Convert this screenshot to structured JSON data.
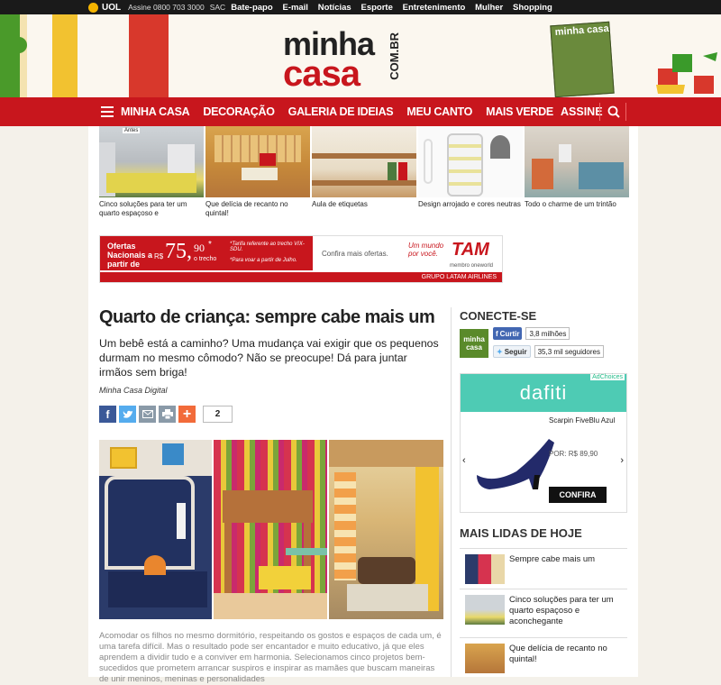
{
  "topbar": {
    "brand": "UOL",
    "assine_text": "Assine 0800 703 3000",
    "sac": "SAC",
    "links": [
      "Bate-papo",
      "E-mail",
      "Notícias",
      "Esporte",
      "Entretenimento",
      "Mulher",
      "Shopping"
    ]
  },
  "header": {
    "logo_line1": "minha",
    "logo_line2": "casa",
    "logo_suffix": "COM.BR",
    "magazine_title": "minha casa"
  },
  "nav": {
    "items": [
      "MINHA CASA",
      "DECORAÇÃO",
      "GALERIA DE IDEIAS",
      "MEU CANTO",
      "MAIS VERDE"
    ],
    "assine": "ASSINE"
  },
  "strip": [
    {
      "caption": "Cinco soluções para ter um quarto espaçoso e",
      "badge": "Antes"
    },
    {
      "caption": "Que delícia de recanto no quintal!"
    },
    {
      "caption": "Aula de etiquetas"
    },
    {
      "caption": "Design arrojado e cores neutras"
    },
    {
      "caption": "Todo o charme de um trintão"
    }
  ],
  "ad": {
    "offer": "Ofertas Nacionais a partir de",
    "currency": "R$",
    "price": "75,",
    "cents": "90",
    "star": "*",
    "per": "o trecho",
    "note1": "*Tarifa referente ao trecho VIX-SDU.",
    "note2": "*Para voar a partir de Julho.",
    "confirm": "Confira mais ofertas.",
    "slogan1": "Um mundo",
    "slogan2": "por você.",
    "airline": "TAM",
    "member": "membro oneworld",
    "group": "GRUPO LATAM AIRLINES"
  },
  "article": {
    "title": "Quarto de criança: sempre cabe mais um",
    "lead": "Um bebê está a caminho? Uma mudança vai exigir que os pequenos durmam no mesmo cômodo? Não se preocupe! Dá para juntar irmãos sem briga!",
    "byline": "Minha Casa Digital",
    "share_count": "2",
    "body": "Acomodar os filhos no mesmo dormitório, respeitando os gostos e espaços de cada um, é uma tarefa difícil. Mas o resultado pode ser encantador e muito educativo, já que eles aprendem a dividir tudo e a conviver em harmonia. Selecionamos cinco projetos bem-sucedidos que prometem arrancar suspiros e inspirar as mamães que buscam maneiras de unir meninos, meninas e personalidades"
  },
  "sidebar": {
    "conecte_title": "CONECTE-SE",
    "conecte_logo": "minha casa",
    "fb_label": "Curtir",
    "fb_count": "3,8 milhões",
    "tw_label": "Seguir",
    "tw_count": "35,3 mil seguidores",
    "ad": {
      "adchoices": "AdChoices",
      "brand": "dafiti",
      "product": "Scarpin FiveBlu Azul",
      "price": "POR: R$ 89,90",
      "cta": "CONFIRA"
    },
    "mais_title": "MAIS LIDAS DE HOJE",
    "mais": [
      {
        "text": "Sempre cabe mais um"
      },
      {
        "text": "Cinco soluções para ter um quarto espaçoso e aconchegante"
      },
      {
        "text": "Que delícia de recanto no quintal!"
      }
    ]
  },
  "colors": {
    "brand_red": "#c8161d",
    "facebook": "#3b5998",
    "twitter": "#55acee",
    "dafiti": "#4ecbb4"
  }
}
